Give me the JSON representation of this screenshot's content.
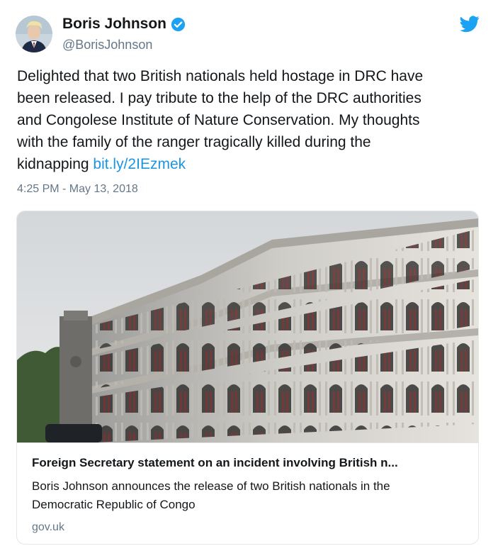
{
  "user": {
    "display_name": "Boris Johnson",
    "handle": "@BorisJohnson",
    "verified": true
  },
  "tweet": {
    "text_lines": [
      "Delighted that two British nationals held hostage in DRC have",
      "been released. I pay tribute to the help of the DRC authorities",
      "and Congolese Institute of Nature Conservation. My thoughts",
      "with the family of the ranger tragically killed during the",
      "kidnapping "
    ],
    "link_text": "bit.ly/2IEzmek",
    "timestamp": "4:25 PM - May 13, 2018"
  },
  "card": {
    "title": "Foreign Secretary statement on an incident involving British n...",
    "description_lines": [
      "Boris Johnson announces the release of two British nationals in the",
      "Democratic Republic of Congo"
    ],
    "domain": "gov.uk"
  },
  "colors": {
    "link": "#1b95e0",
    "secondary_text": "#657786",
    "twitter_blue": "#1da1f2"
  },
  "icons": {
    "verified": "verified-badge-icon",
    "logo": "twitter-bird-icon"
  }
}
